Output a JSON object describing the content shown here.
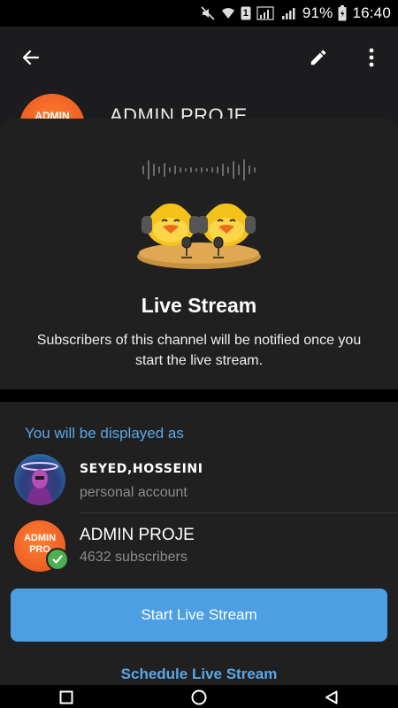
{
  "status_bar": {
    "battery_percent": "91%",
    "time": "16:40",
    "sim_badge": "1",
    "icons": [
      "mute-icon",
      "wifi-icon",
      "sim-icon",
      "signal-icon",
      "battery-icon"
    ]
  },
  "appbar": {
    "icons": [
      "back-arrow-icon",
      "pencil-icon",
      "more-vert-icon"
    ]
  },
  "channel": {
    "title": "ADMIN PROJE",
    "avatar_text": "ADMIN"
  },
  "sheet": {
    "title": "Live Stream",
    "description": "Subscribers of this channel will be notified once you start the live stream.",
    "section_label": "You will be displayed as",
    "accounts": [
      {
        "name": "SEYED,HOSSEINI",
        "subtitle": "personal account"
      },
      {
        "name": "ADMIN PROJE",
        "subtitle": "4632 subscribers",
        "avatar_text": "ADMIN PRO",
        "selected": true
      }
    ],
    "start_button": "Start Live Stream",
    "schedule_button": "Schedule Live Stream"
  },
  "nav_bar": {
    "icons": [
      "recents-square-icon",
      "home-circle-icon",
      "back-triangle-icon"
    ]
  },
  "colors": {
    "accent": "#4c9fe3",
    "link": "#5aa7e6",
    "sheet_bg": "#202021",
    "check_green": "#4caf50"
  }
}
